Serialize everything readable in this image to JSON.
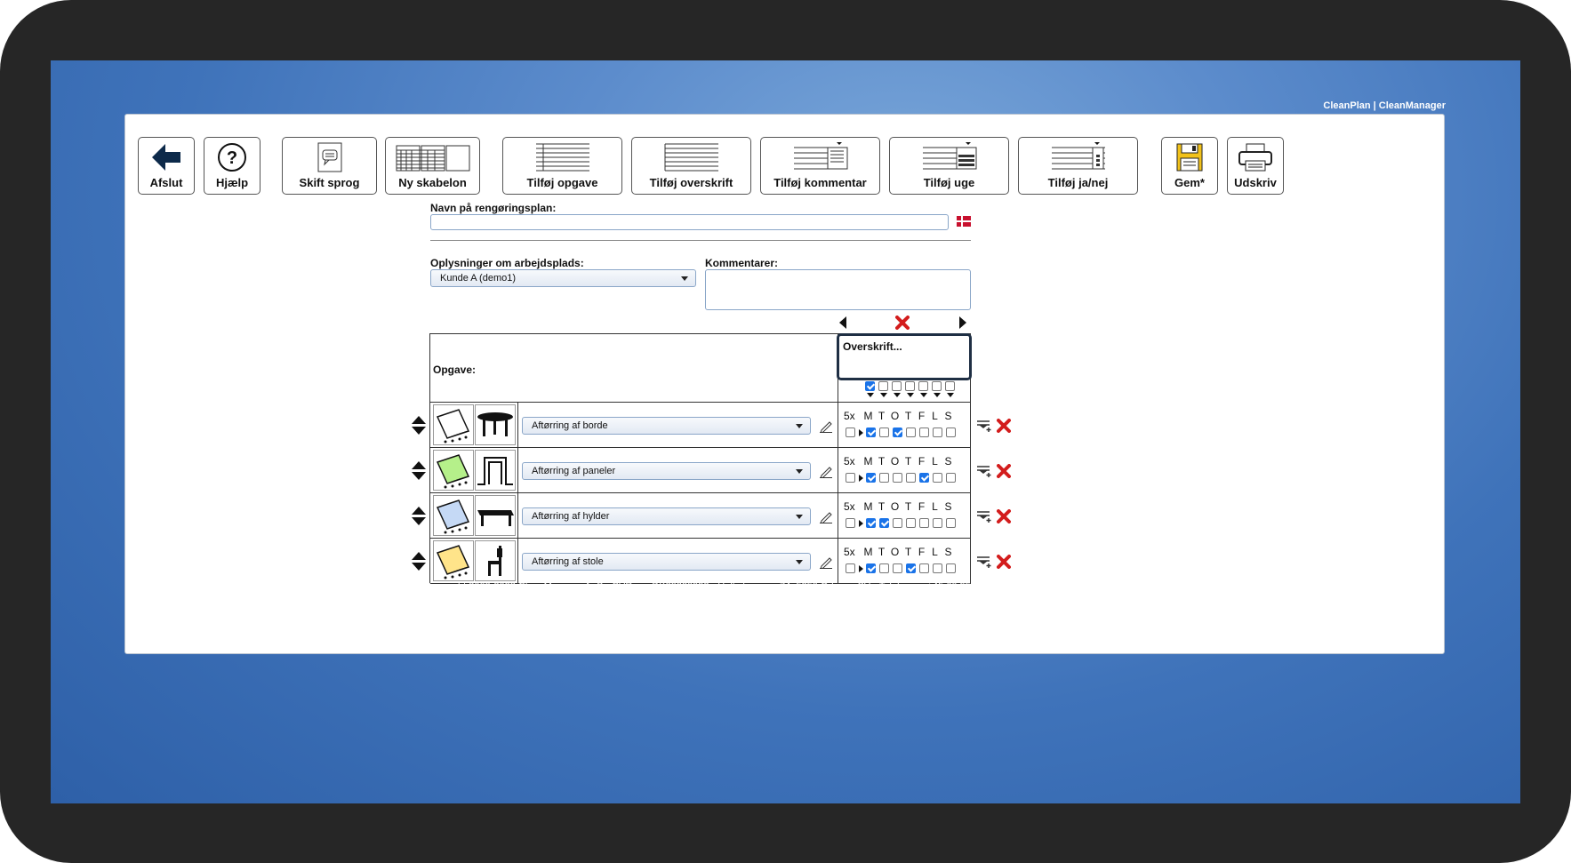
{
  "brand": "CleanPlan | CleanManager",
  "toolbar": {
    "exit": "Afslut",
    "help": "Hjælp",
    "language": "Skift sprog",
    "new_template": "Ny skabelon",
    "add_task": "Tilføj opgave",
    "add_heading": "Tilføj overskrift",
    "add_comment": "Tilføj kommentar",
    "add_week": "Tilføj uge",
    "add_yesno": "Tilføj ja/nej",
    "save": "Gem*",
    "print": "Udskriv"
  },
  "form": {
    "plan_name_label": "Navn på rengøringsplan:",
    "plan_name_value": "",
    "workplace_label": "Oplysninger om arbejdsplads:",
    "workplace_value": "Kunde A (demo1)",
    "comments_label": "Kommentarer:",
    "comments_value": ""
  },
  "table": {
    "task_header": "Opgave:",
    "column_heading_placeholder": "Overskrift...",
    "frequency_label": "5x",
    "day_letters": [
      "M",
      "T",
      "O",
      "T",
      "F",
      "L",
      "S"
    ],
    "header_checks": [
      true,
      false,
      false,
      false,
      false,
      false,
      false
    ],
    "rows": [
      {
        "task": "Aftørring af borde",
        "cloth": "white",
        "object": "table",
        "checks": [
          true,
          false,
          true,
          false,
          false,
          false,
          false
        ]
      },
      {
        "task": "Aftørring af paneler",
        "cloth": "green",
        "object": "panel",
        "checks": [
          true,
          false,
          false,
          false,
          true,
          false,
          false
        ]
      },
      {
        "task": "Aftørring af hylder",
        "cloth": "blue",
        "object": "shelf",
        "checks": [
          true,
          true,
          false,
          false,
          false,
          false,
          false
        ]
      },
      {
        "task": "Aftørring af stole",
        "cloth": "yellow",
        "object": "chair",
        "checks": [
          true,
          false,
          false,
          true,
          false,
          false,
          false
        ]
      }
    ]
  },
  "colors": {
    "cloth_white": "#ffffff",
    "cloth_green": "#b5f08a",
    "cloth_blue": "#c5d9f5",
    "cloth_yellow": "#ffe48a",
    "accent": "#1a73e8",
    "delete": "#d31d1d"
  },
  "footer": {
    "copyright": "© Copyright 2009-2022 CleanManager ApS - CVR-nr.: DK39230992 - Holkebjergvej 74, 5250 Odense SV - Telefonnr.: +45 60 95 03 48 - E-mail: support@cleanmanager.dk",
    "cookies": "Cookies på denne side"
  }
}
